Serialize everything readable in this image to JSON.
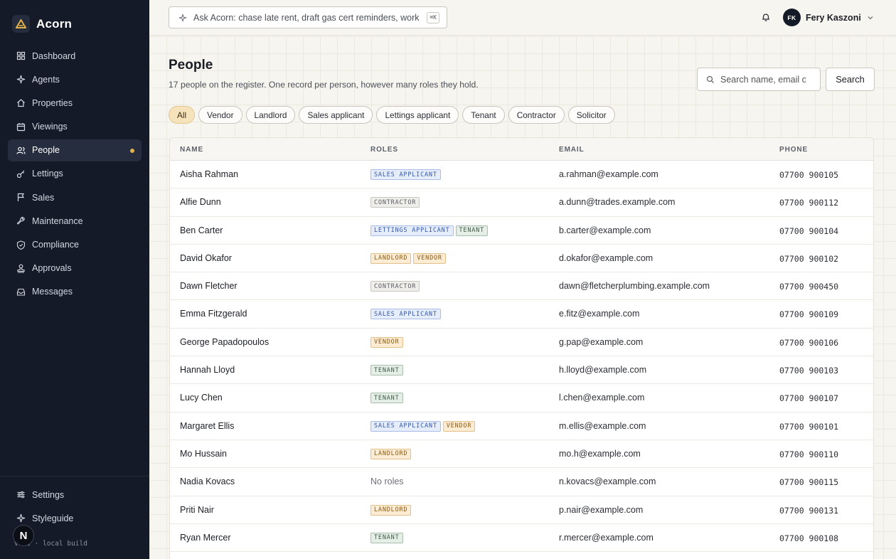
{
  "app": {
    "brand": "Acorn",
    "build": "v0.1 · local build",
    "n_badge": "N"
  },
  "sidebar": {
    "items": [
      {
        "label": "Dashboard",
        "icon": "grid-icon",
        "active": false
      },
      {
        "label": "Agents",
        "icon": "sparkle-icon",
        "active": false
      },
      {
        "label": "Properties",
        "icon": "home-icon",
        "active": false
      },
      {
        "label": "Viewings",
        "icon": "calendar-icon",
        "active": false
      },
      {
        "label": "People",
        "icon": "users-icon",
        "active": true
      },
      {
        "label": "Lettings",
        "icon": "key-icon",
        "active": false
      },
      {
        "label": "Sales",
        "icon": "flag-icon",
        "active": false
      },
      {
        "label": "Maintenance",
        "icon": "wrench-icon",
        "active": false
      },
      {
        "label": "Compliance",
        "icon": "shield-icon",
        "active": false
      },
      {
        "label": "Approvals",
        "icon": "stamp-icon",
        "active": false
      },
      {
        "label": "Messages",
        "icon": "inbox-icon",
        "active": false
      }
    ],
    "bottom": [
      {
        "label": "Settings",
        "icon": "sliders-icon"
      },
      {
        "label": "Styleguide",
        "icon": "sparkle-icon"
      }
    ]
  },
  "topbar": {
    "ask_text": "Ask Acorn: chase late rent, draft gas cert reminders, work th",
    "ask_kbd": "⌘K",
    "user_initials": "FK",
    "user_name": "Fery Kaszoni"
  },
  "page": {
    "title": "People",
    "subtitle": "17 people on the register. One record per person, however many roles they hold.",
    "search_placeholder": "Search name, email or",
    "search_button": "Search",
    "filters": [
      {
        "label": "All",
        "active": true
      },
      {
        "label": "Vendor",
        "active": false
      },
      {
        "label": "Landlord",
        "active": false
      },
      {
        "label": "Sales applicant",
        "active": false
      },
      {
        "label": "Lettings applicant",
        "active": false
      },
      {
        "label": "Tenant",
        "active": false
      },
      {
        "label": "Contractor",
        "active": false
      },
      {
        "label": "Solicitor",
        "active": false
      }
    ]
  },
  "table": {
    "columns": {
      "name": "NAME",
      "roles": "ROLES",
      "email": "EMAIL",
      "phone": "PHONE"
    },
    "no_roles_label": "No roles",
    "rows": [
      {
        "name": "Aisha Rahman",
        "roles": [
          "SALES APPLICANT"
        ],
        "email": "a.rahman@example.com",
        "phone": "07700 900105"
      },
      {
        "name": "Alfie Dunn",
        "roles": [
          "CONTRACTOR"
        ],
        "email": "a.dunn@trades.example.com",
        "phone": "07700 900112"
      },
      {
        "name": "Ben Carter",
        "roles": [
          "LETTINGS APPLICANT",
          "TENANT"
        ],
        "email": "b.carter@example.com",
        "phone": "07700 900104"
      },
      {
        "name": "David Okafor",
        "roles": [
          "LANDLORD",
          "VENDOR"
        ],
        "email": "d.okafor@example.com",
        "phone": "07700 900102"
      },
      {
        "name": "Dawn Fletcher",
        "roles": [
          "CONTRACTOR"
        ],
        "email": "dawn@fletcherplumbing.example.com",
        "phone": "07700 900450"
      },
      {
        "name": "Emma Fitzgerald",
        "roles": [
          "SALES APPLICANT"
        ],
        "email": "e.fitz@example.com",
        "phone": "07700 900109"
      },
      {
        "name": "George Papadopoulos",
        "roles": [
          "VENDOR"
        ],
        "email": "g.pap@example.com",
        "phone": "07700 900106"
      },
      {
        "name": "Hannah Lloyd",
        "roles": [
          "TENANT"
        ],
        "email": "h.lloyd@example.com",
        "phone": "07700 900103"
      },
      {
        "name": "Lucy Chen",
        "roles": [
          "TENANT"
        ],
        "email": "l.chen@example.com",
        "phone": "07700 900107"
      },
      {
        "name": "Margaret Ellis",
        "roles": [
          "SALES APPLICANT",
          "VENDOR"
        ],
        "email": "m.ellis@example.com",
        "phone": "07700 900101"
      },
      {
        "name": "Mo Hussain",
        "roles": [
          "LANDLORD"
        ],
        "email": "mo.h@example.com",
        "phone": "07700 900110"
      },
      {
        "name": "Nadia Kovacs",
        "roles": [],
        "email": "n.kovacs@example.com",
        "phone": "07700 900115"
      },
      {
        "name": "Priti Nair",
        "roles": [
          "LANDLORD"
        ],
        "email": "p.nair@example.com",
        "phone": "07700 900131"
      },
      {
        "name": "Ryan Mercer",
        "roles": [
          "TENANT"
        ],
        "email": "r.mercer@example.com",
        "phone": "07700 900108"
      }
    ]
  },
  "colors": {
    "accent": "#e1b14a",
    "sidebar_bg": "#141a28",
    "active_chip": "#f6e3bc"
  }
}
